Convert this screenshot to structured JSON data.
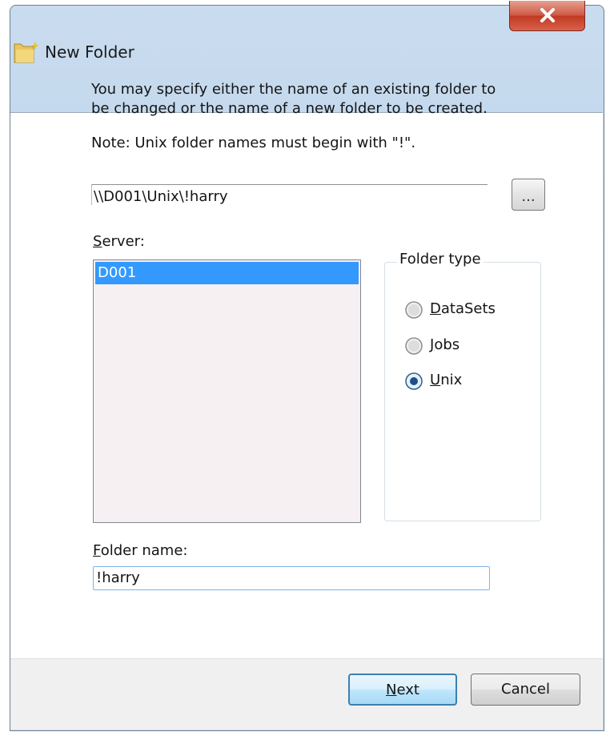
{
  "window": {
    "title": "New Folder",
    "close_glyph": "✕"
  },
  "instructions": {
    "line1": "You may specify either the name of an existing folder to",
    "line2": "be changed or the name of a new folder to be created.",
    "note": "Note: Unix folder names must begin with \"!\"."
  },
  "path": {
    "value": "\\\\D001\\Unix\\!harry",
    "browse_label": "..."
  },
  "server": {
    "label_first": "S",
    "label_rest": "erver:",
    "items": [
      "D001"
    ],
    "selected": "D001"
  },
  "folder_type": {
    "legend": "Folder type",
    "options": [
      {
        "first": "D",
        "rest": "ataSets",
        "checked": false
      },
      {
        "first": "J",
        "rest": "obs",
        "checked": false
      },
      {
        "first": "U",
        "rest": "nix",
        "checked": true
      }
    ]
  },
  "folder_name": {
    "label_first": "F",
    "label_rest": "older name:",
    "value": "!harry"
  },
  "buttons": {
    "next_first": "N",
    "next_rest": "ext",
    "cancel": "Cancel"
  },
  "icons": {
    "title_icon": "new-folder-icon",
    "close": "close-icon"
  },
  "colors": {
    "selection": "#3399ff",
    "close_button": "#c9452f",
    "default_button_border": "#3c7fb1"
  }
}
